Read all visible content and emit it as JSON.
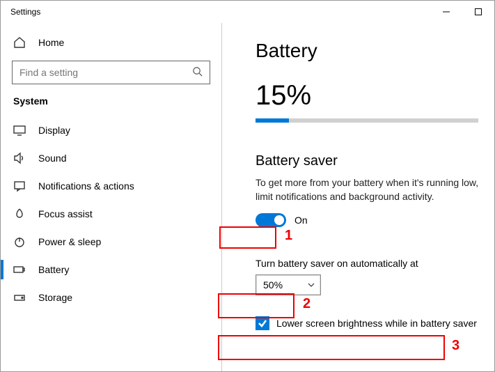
{
  "window": {
    "title": "Settings"
  },
  "sidebar": {
    "home": "Home",
    "search_placeholder": "Find a setting",
    "category": "System",
    "items": [
      {
        "label": "Display"
      },
      {
        "label": "Sound"
      },
      {
        "label": "Notifications & actions"
      },
      {
        "label": "Focus assist"
      },
      {
        "label": "Power & sleep"
      },
      {
        "label": "Battery"
      },
      {
        "label": "Storage"
      }
    ]
  },
  "page": {
    "title": "Battery",
    "percent_text": "15%",
    "percent_value": 15,
    "saver": {
      "heading": "Battery saver",
      "description": "To get more from your battery when it's running low, limit notifications and background activity.",
      "toggle_label": "On",
      "auto_label": "Turn battery saver on automatically at",
      "auto_value": "50%",
      "brightness_label": "Lower screen brightness while in battery saver"
    }
  },
  "annotations": {
    "n1": "1",
    "n2": "2",
    "n3": "3"
  }
}
